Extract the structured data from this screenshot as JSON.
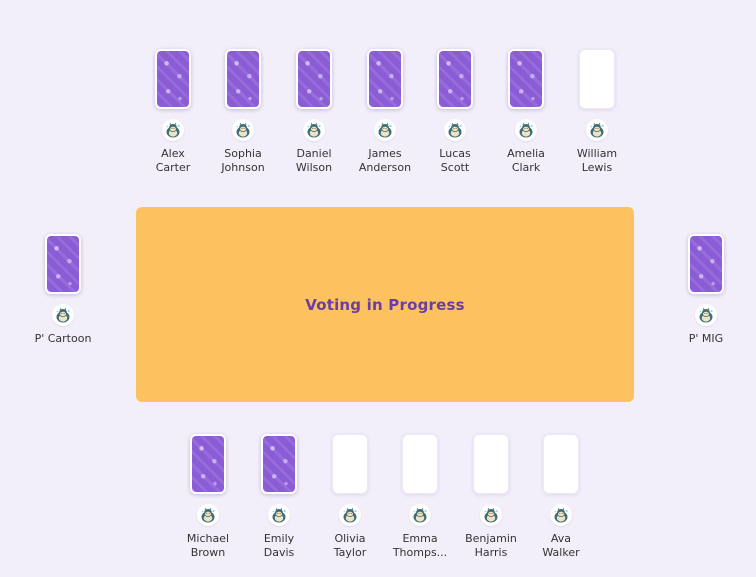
{
  "table": {
    "status": "Voting in Progress"
  },
  "players": {
    "top": [
      {
        "first": "Alex",
        "last": "Carter",
        "voted": true
      },
      {
        "first": "Sophia",
        "last": "Johnson",
        "voted": true
      },
      {
        "first": "Daniel",
        "last": "Wilson",
        "voted": true
      },
      {
        "first": "James",
        "last": "Anderson",
        "voted": true
      },
      {
        "first": "Lucas",
        "last": "Scott",
        "voted": true
      },
      {
        "first": "Amelia",
        "last": "Clark",
        "voted": true
      },
      {
        "first": "William",
        "last": "Lewis",
        "voted": false
      }
    ],
    "left": {
      "name": "P' Cartoon",
      "voted": true
    },
    "right": {
      "name": "P' MIG",
      "voted": true
    },
    "bottom": [
      {
        "first": "Michael",
        "last": "Brown",
        "voted": true
      },
      {
        "first": "Emily",
        "last": "Davis",
        "voted": true
      },
      {
        "first": "Olivia",
        "last": "Taylor",
        "voted": false
      },
      {
        "first": "Emma",
        "last": "Thomps...",
        "voted": false
      },
      {
        "first": "Benjamin",
        "last": "Harris",
        "voted": false
      },
      {
        "first": "Ava",
        "last": "Walker",
        "voted": false
      }
    ]
  },
  "icons": {
    "card_back": "card-back-pattern",
    "avatar": "snorlax-avatar"
  },
  "colors": {
    "background": "#f3effa",
    "table": "#fdc260",
    "table_text": "#6b3ea3",
    "card_voted": "#8a5cd6",
    "card_empty": "#ffffff"
  }
}
